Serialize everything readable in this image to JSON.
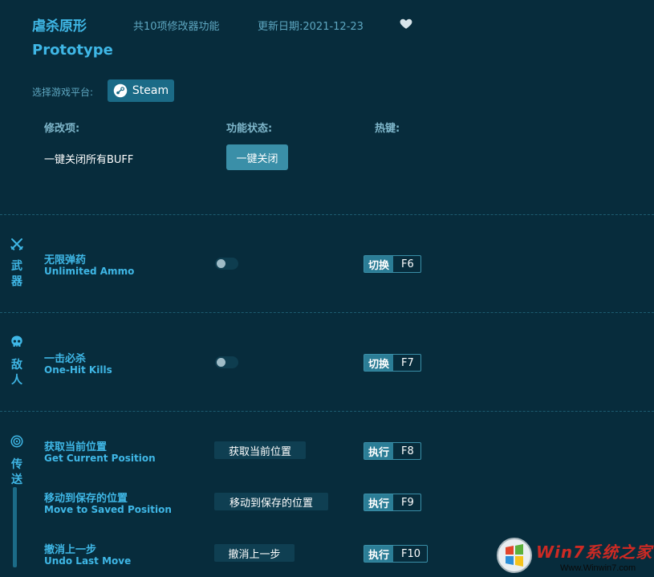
{
  "header": {
    "title_cn": "虐杀原形",
    "title_en": "Prototype",
    "feature_count": "共10项修改器功能",
    "update_date": "更新日期:2021-12-23",
    "favorite_icon": "heart-icon"
  },
  "platform": {
    "label": "选择游戏平台:",
    "steam_label": "Steam"
  },
  "columns": {
    "item": "修改项:",
    "status": "功能状态:",
    "hotkey": "热键:"
  },
  "buff": {
    "label": "一键关闭所有BUFF",
    "button": "一键关闭"
  },
  "categories": {
    "weapons": {
      "chars": [
        "武",
        "器"
      ],
      "icon": "crossed-swords-icon"
    },
    "enemies": {
      "chars": [
        "敌",
        "人"
      ],
      "icon": "skull-icon"
    },
    "teleport": {
      "chars": [
        "传",
        "送"
      ],
      "icon": "location-icon"
    }
  },
  "items": [
    {
      "cn": "无限弹药",
      "en": "Unlimited Ammo",
      "key_action": "切换",
      "key": "F6"
    },
    {
      "cn": "一击必杀",
      "en": "One-Hit Kills",
      "key_action": "切换",
      "key": "F7"
    },
    {
      "cn": "获取当前位置",
      "en": "Get Current Position",
      "button": "获取当前位置",
      "key_action": "执行",
      "key": "F8"
    },
    {
      "cn": "移动到保存的位置",
      "en": "Move to Saved Position",
      "button": "移动到保存的位置",
      "key_action": "执行",
      "key": "F9"
    },
    {
      "cn": "撤消上一步",
      "en": "Undo Last Move",
      "button": "撤消上一步",
      "key_action": "执行",
      "key": "F10"
    }
  ],
  "watermark": {
    "text": "Win7系统之家",
    "url": "Www.Winwin7.com"
  },
  "colors": {
    "background": "#072c3c",
    "accent": "#3fb7e6",
    "button": "#3a8fa8"
  }
}
